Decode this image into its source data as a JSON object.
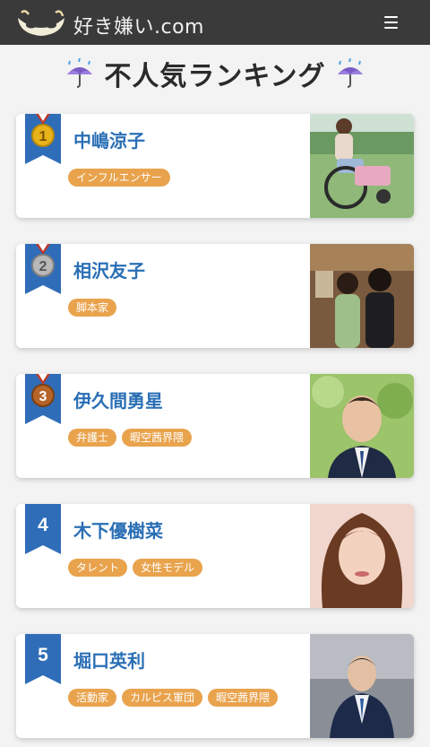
{
  "header": {
    "site_name": "好き嫌い.com",
    "colors": {
      "bar": "#3a3a3a",
      "text": "#f0f0f0"
    }
  },
  "page": {
    "title": "不人気ランキング",
    "title_icon": "umbrella-rain-icon"
  },
  "ranking": [
    {
      "rank": "1",
      "name": "中嶋涼子",
      "tags": [
        "インフルエンサー"
      ],
      "badge": "gold-medal-icon"
    },
    {
      "rank": "2",
      "name": "相沢友子",
      "tags": [
        "脚本家"
      ],
      "badge": "silver-medal-icon"
    },
    {
      "rank": "3",
      "name": "伊久間勇星",
      "tags": [
        "弁護士",
        "暇空茜界隈"
      ],
      "badge": "bronze-medal-icon"
    },
    {
      "rank": "4",
      "name": "木下優樹菜",
      "tags": [
        "タレント",
        "女性モデル"
      ],
      "badge": "blue-ribbon-icon"
    },
    {
      "rank": "5",
      "name": "堀口英利",
      "tags": [
        "活動家",
        "カルピス軍団",
        "暇空茜界隈"
      ],
      "badge": "blue-ribbon-icon"
    }
  ],
  "colors": {
    "name": "#2a6fb5",
    "tag_bg": "#e9a34d",
    "ribbon": "#2f6db8",
    "gold": "#e8b21a",
    "silver": "#9a9a9a",
    "bronze": "#b5652a"
  }
}
